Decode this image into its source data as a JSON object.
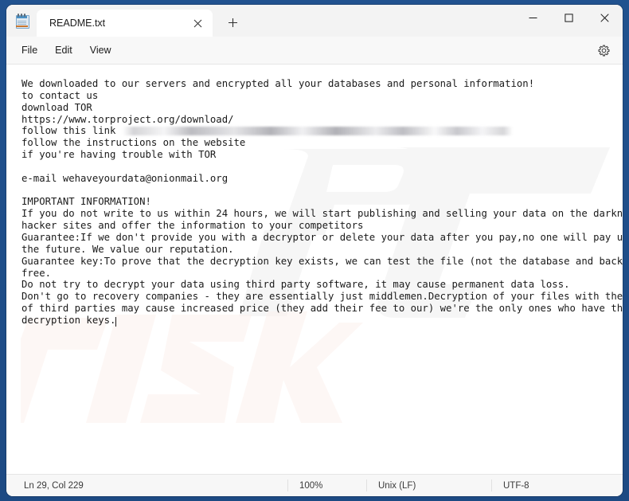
{
  "window": {
    "app_icon": "notepad-icon",
    "caption": {
      "minimize": "minimize-icon",
      "maximize": "maximize-icon",
      "close": "close-icon"
    }
  },
  "tabs": {
    "active": {
      "title": "README.txt",
      "close_label": "close-tab-icon"
    },
    "new_tab_label": "new-tab-icon"
  },
  "menubar": {
    "items": [
      {
        "label": "File"
      },
      {
        "label": "Edit"
      },
      {
        "label": "View"
      }
    ],
    "settings_icon": "gear-icon"
  },
  "document": {
    "line_1": "We downloaded to our servers and encrypted all your databases and personal information!",
    "line_2": "to contact us",
    "line_3": "download TOR",
    "line_4": "https://www.torproject.org/download/",
    "line_5_prefix": "follow this link ",
    "line_5_redacted": "[blurred-link-redacted]",
    "line_6": "follow the instructions on the website",
    "line_7": "if you're having trouble with TOR",
    "line_8": "e-mail wehaveyourdata@onionmail.org",
    "line_9": "IMPORTANT INFORMATION!",
    "para_1_a": "If you do not write to us within 24 hours, we will start publishing and selling your data on the darknet on",
    "para_1_b": "hacker sites and offer the information to your competitors",
    "para_2_a": "Guarantee:If we don't provide you with a decryptor or delete your data after you pay,no one will pay us in",
    "para_2_b": "the future. We value our reputation.",
    "para_3_a": "Guarantee key:To prove that the decryption key exists, we can test the file (not the database and backup) for",
    "para_3_b": "free.",
    "para_4": "Do not try to decrypt your data using third party software, it may cause permanent data loss.",
    "para_5_a": "Don't go to recovery companies - they are essentially just middlemen.Decryption of your files with the help",
    "para_5_b": "of third parties may cause increased price (they add their fee to our) we're the only ones who have the",
    "para_5_c": "decryption keys."
  },
  "statusbar": {
    "position": "Ln 29, Col 229",
    "zoom": "100%",
    "line_ending": "Unix (LF)",
    "encoding": "UTF-8"
  },
  "colors": {
    "desktop": "#21528f",
    "window_chrome": "#f3f3f3",
    "editor_background": "#ffffff",
    "text": "#1a1a1a"
  }
}
